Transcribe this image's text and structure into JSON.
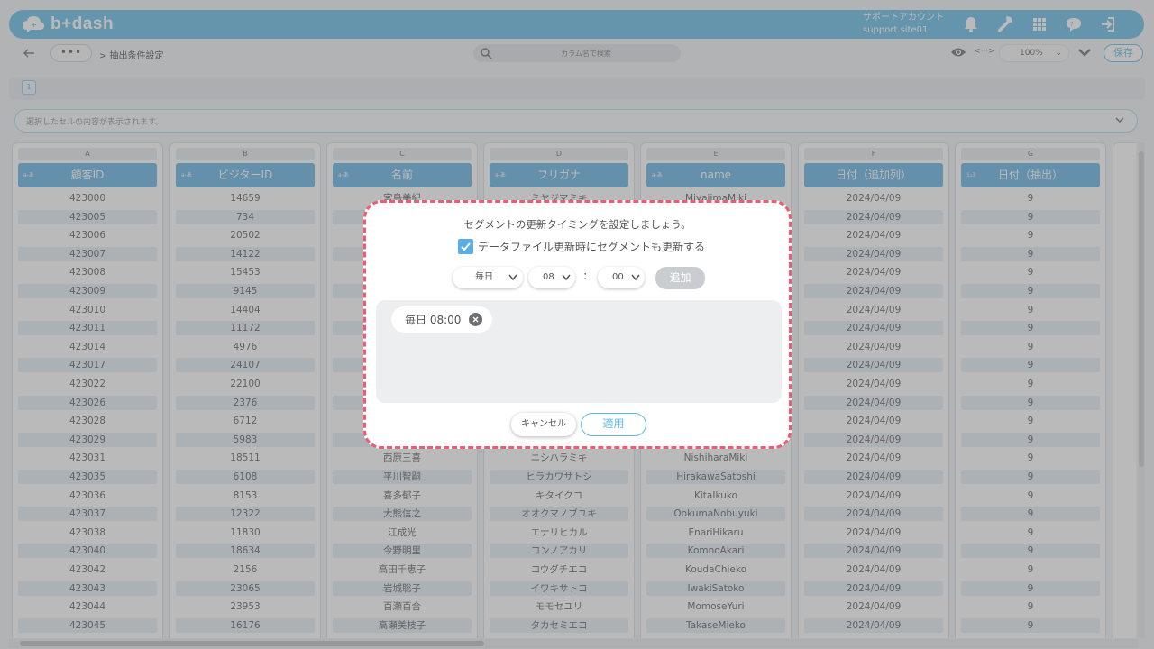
{
  "app": {
    "logo_text": "b+dash"
  },
  "header": {
    "account_name": "サポートアカウント",
    "account_site": "support.site01",
    "icons": [
      "bell-icon",
      "wrench-icon",
      "apps-grid-icon",
      "chat-icon",
      "logout-icon"
    ]
  },
  "toolbar": {
    "more_label": "•••",
    "breadcrumb": "> 抽出条件設定",
    "search_placeholder": "カラム名で検索",
    "zoom": "100%",
    "save_label": "保存"
  },
  "pager": {
    "current": "1"
  },
  "cellbar": {
    "placeholder": "選択したセルの内容が表示されます。"
  },
  "columns": [
    {
      "letter": "A",
      "tag": "a-あ",
      "header": "顧客ID"
    },
    {
      "letter": "B",
      "tag": "a-あ",
      "header": "ビジターID"
    },
    {
      "letter": "C",
      "tag": "a-あ",
      "header": "名前"
    },
    {
      "letter": "D",
      "tag": "a-あ",
      "header": "フリガナ"
    },
    {
      "letter": "E",
      "tag": "a-あ",
      "header": "name"
    },
    {
      "letter": "F",
      "tag": "",
      "header": "日付（追加列）"
    },
    {
      "letter": "G",
      "tag": "1₂3",
      "header": "日付（抽出）"
    }
  ],
  "rows": [
    [
      "423000",
      "14659",
      "宮島美紀",
      "ミヤジマミキ",
      "MiyajimaMiki",
      "2024/04/09",
      "9"
    ],
    [
      "423005",
      "734",
      "",
      "",
      "",
      "2024/04/09",
      "9"
    ],
    [
      "423006",
      "20502",
      "",
      "",
      "",
      "2024/04/09",
      "9"
    ],
    [
      "423007",
      "14122",
      "",
      "",
      "",
      "2024/04/09",
      "9"
    ],
    [
      "423008",
      "15453",
      "",
      "",
      "",
      "2024/04/09",
      "9"
    ],
    [
      "423009",
      "9145",
      "",
      "",
      "",
      "2024/04/09",
      "9"
    ],
    [
      "423010",
      "14404",
      "",
      "",
      "",
      "2024/04/09",
      "9"
    ],
    [
      "423011",
      "11172",
      "",
      "",
      "",
      "2024/04/09",
      "9"
    ],
    [
      "423014",
      "4976",
      "",
      "",
      "",
      "2024/04/09",
      "9"
    ],
    [
      "423017",
      "24107",
      "",
      "",
      "",
      "2024/04/09",
      "9"
    ],
    [
      "423022",
      "22100",
      "",
      "",
      "",
      "2024/04/09",
      "9"
    ],
    [
      "423026",
      "2376",
      "",
      "",
      "",
      "2024/04/09",
      "9"
    ],
    [
      "423028",
      "6712",
      "",
      "",
      "",
      "2024/04/09",
      "9"
    ],
    [
      "423029",
      "5983",
      "",
      "",
      "",
      "2024/04/09",
      "9"
    ],
    [
      "423031",
      "18511",
      "西原三喜",
      "ニシハラミキ",
      "NishiharaMiki",
      "2024/04/09",
      "9"
    ],
    [
      "423035",
      "6108",
      "平川智嗣",
      "ヒラカワサトシ",
      "HirakawaSatoshi",
      "2024/04/09",
      "9"
    ],
    [
      "423036",
      "8153",
      "喜多郁子",
      "キタイクコ",
      "KitaIkuko",
      "2024/04/09",
      "9"
    ],
    [
      "423037",
      "12322",
      "大熊信之",
      "オオクマノブユキ",
      "OokumaNobuyuki",
      "2024/04/09",
      "9"
    ],
    [
      "423038",
      "11830",
      "江成光",
      "エナリヒカル",
      "EnariHikaru",
      "2024/04/09",
      "9"
    ],
    [
      "423040",
      "18634",
      "今野明里",
      "コンノアカリ",
      "KomnoAkari",
      "2024/04/09",
      "9"
    ],
    [
      "423042",
      "2156",
      "高田千恵子",
      "コウダチエコ",
      "KoudaChieko",
      "2024/04/09",
      "9"
    ],
    [
      "423043",
      "23065",
      "岩城聡子",
      "イワキサトコ",
      "IwakiSatoko",
      "2024/04/09",
      "9"
    ],
    [
      "423044",
      "23953",
      "百瀬百合",
      "モモセユリ",
      "MomoseYuri",
      "2024/04/09",
      "9"
    ],
    [
      "423045",
      "16176",
      "高瀬美枝子",
      "タカセミエコ",
      "TakaseMieko",
      "2024/04/09",
      "9"
    ]
  ],
  "dialog": {
    "title": "セグメントの更新タイミングを設定しましょう。",
    "checkbox_label": "データファイル更新時にセグメントも更新する",
    "checkbox_checked": true,
    "frequency": "毎日",
    "hour": "08",
    "colon": ":",
    "minute": "00",
    "add_label": "追加",
    "schedules": [
      "毎日 08:00"
    ],
    "cancel_label": "キャンセル",
    "apply_label": "適用"
  },
  "colors": {
    "accent": "#5bb9e6",
    "header_cell": "#5aaee3",
    "dialog_border": "#f05b72"
  }
}
